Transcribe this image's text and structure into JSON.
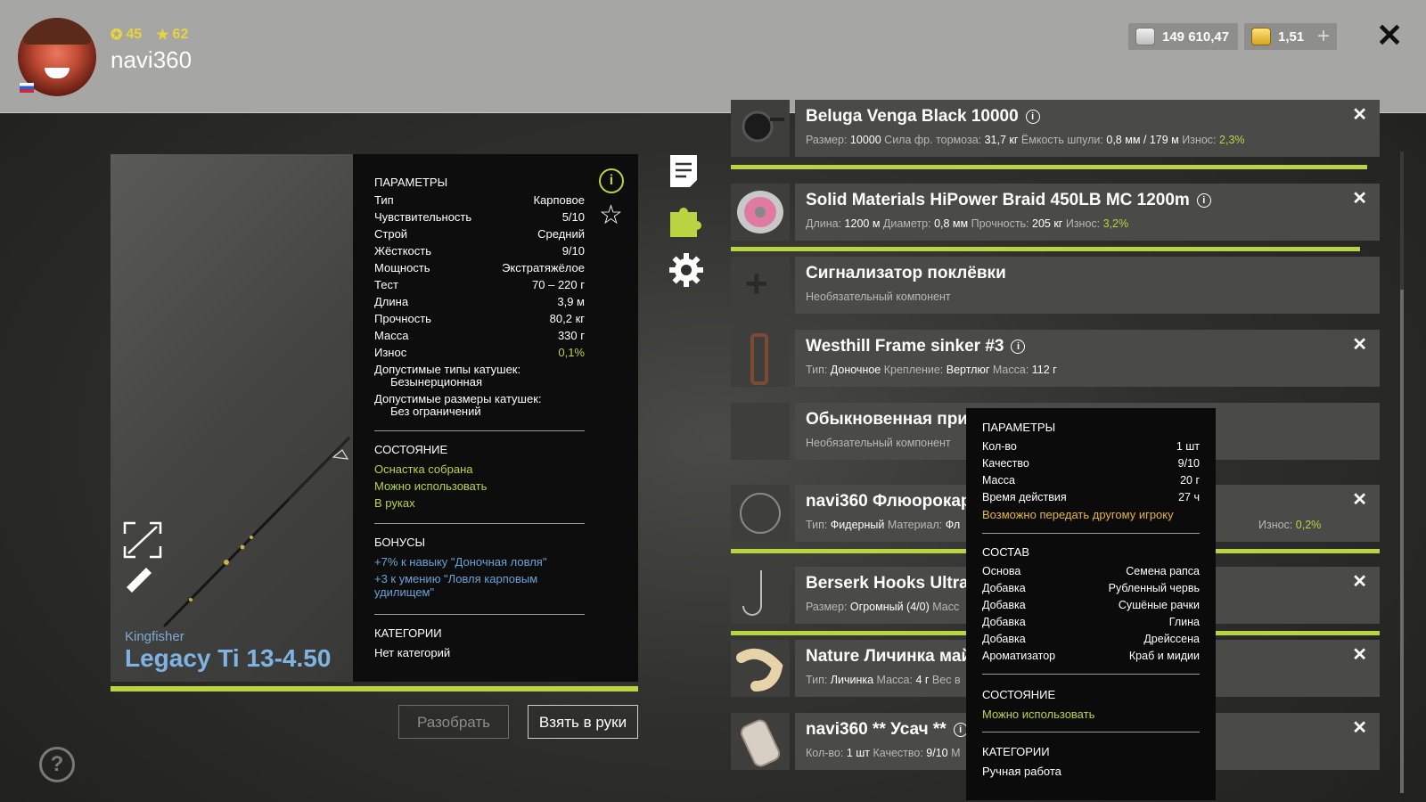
{
  "header": {
    "username": "navi360",
    "level": "45",
    "rating": "62",
    "silver": "149 610,47",
    "gold": "1,51"
  },
  "rod": {
    "brand": "Kingfisher",
    "model": "Legacy Ti 13-4.50"
  },
  "params": {
    "title": "ПАРАМЕТРЫ",
    "rows": [
      {
        "label": "Тип",
        "value": "Карповое"
      },
      {
        "label": "Чувствительность",
        "value": "5/10"
      },
      {
        "label": "Строй",
        "value": "Средний"
      },
      {
        "label": "Жёсткость",
        "value": "9/10"
      },
      {
        "label": "Мощность",
        "value": "Экстратяжёлое"
      },
      {
        "label": "Тест",
        "value": "70 – 220 г"
      },
      {
        "label": "Длина",
        "value": "3,9 м"
      },
      {
        "label": "Прочность",
        "value": "80,2 кг"
      },
      {
        "label": "Масса",
        "value": "330 г"
      },
      {
        "label": "Износ",
        "value": "0,1%"
      }
    ],
    "reel_types_label": "Допустимые типы катушек:",
    "reel_types_value": "Безынерционная",
    "reel_sizes_label": "Допустимые размеры катушек:",
    "reel_sizes_value": "Без ограничений",
    "state_title": "СОСТОЯНИЕ",
    "state": [
      "Оснастка собрана",
      "Можно использовать",
      "В руках"
    ],
    "bonus_title": "БОНУСЫ",
    "bonus1": "+7% к навыку \"Доночная ловля\"",
    "bonus2": "+3 к умению \"Ловля карповым удилищем\"",
    "cat_title": "КАТЕГОРИИ",
    "cat_value": "Нет категорий"
  },
  "buttons": {
    "disassemble": "Разобрать",
    "take": "Взять в руки"
  },
  "items": [
    {
      "title": "Beluga Venga Black 10000",
      "sub": [
        [
          "Размер: ",
          "10000"
        ],
        [
          " Сила фр. тормоза: ",
          "31,7 кг"
        ],
        [
          " Ёмкость шпули: ",
          "0,8 мм / 179 м"
        ],
        [
          " Износ: ",
          ""
        ]
      ],
      "wear": "2,3%"
    },
    {
      "title": "Solid Materials HiPower Braid 450LB MC 1200m",
      "sub": [
        [
          "Длина: ",
          "1200 м"
        ],
        [
          " Диаметр: ",
          "0,8 мм"
        ],
        [
          " Прочность: ",
          "205 кг"
        ],
        [
          " Износ: ",
          ""
        ]
      ],
      "wear": "3,2%"
    },
    {
      "title": "Сигнализатор поклёвки",
      "opt": "Необязательный компонент"
    },
    {
      "title": "Westhill Frame sinker #3",
      "sub": [
        [
          "Тип: ",
          "Доночное"
        ],
        [
          " Крепление: ",
          "Вертлюг"
        ],
        [
          " Масса: ",
          "112 г"
        ]
      ]
    },
    {
      "title": "Обыкновенная прик",
      "opt": "Необязательный компонент"
    },
    {
      "title": "navi360 Флюорокар",
      "sub": [
        [
          "Тип: ",
          "Фидерный"
        ],
        [
          " Материал: ",
          "Фл"
        ]
      ],
      "wear_tail": "Износ: ",
      "wear": "0,2%"
    },
    {
      "title": "Berserk Hooks Ultra S",
      "sub": [
        [
          "Размер: ",
          "Огромный (4/0)"
        ],
        [
          " Масс",
          ""
        ]
      ]
    },
    {
      "title": "Nature Личинка май",
      "sub": [
        [
          "Тип: ",
          "Личинка"
        ],
        [
          " Масса: ",
          "4 г"
        ],
        [
          " Вес в",
          ""
        ]
      ]
    },
    {
      "title": "navi360 ** Усач **",
      "sub": [
        [
          "Кол-во: ",
          "1 шт"
        ],
        [
          " Качество: ",
          "9/10"
        ],
        [
          " М",
          ""
        ]
      ]
    }
  ],
  "tooltip": {
    "params_title": "ПАРАМЕТРЫ",
    "rows": [
      {
        "label": "Кол-во",
        "value": "1 шт"
      },
      {
        "label": "Качество",
        "value": "9/10"
      },
      {
        "label": "Масса",
        "value": "20 г"
      },
      {
        "label": "Время действия",
        "value": "27 ч"
      }
    ],
    "transfer": "Возможно передать другому игроку",
    "comp_title": "СОСТАВ",
    "comp": [
      {
        "label": "Основа",
        "value": "Семена рапса"
      },
      {
        "label": "Добавка",
        "value": "Рубленный червь"
      },
      {
        "label": "Добавка",
        "value": "Сушёные рачки"
      },
      {
        "label": "Добавка",
        "value": "Глина"
      },
      {
        "label": "Добавка",
        "value": "Дрейссена"
      },
      {
        "label": "Ароматизатор",
        "value": "Краб и мидии"
      }
    ],
    "state_title": "СОСТОЯНИЕ",
    "state": "Можно использовать",
    "cat_title": "КАТЕГОРИИ",
    "cat": "Ручная работа"
  },
  "help": "?"
}
